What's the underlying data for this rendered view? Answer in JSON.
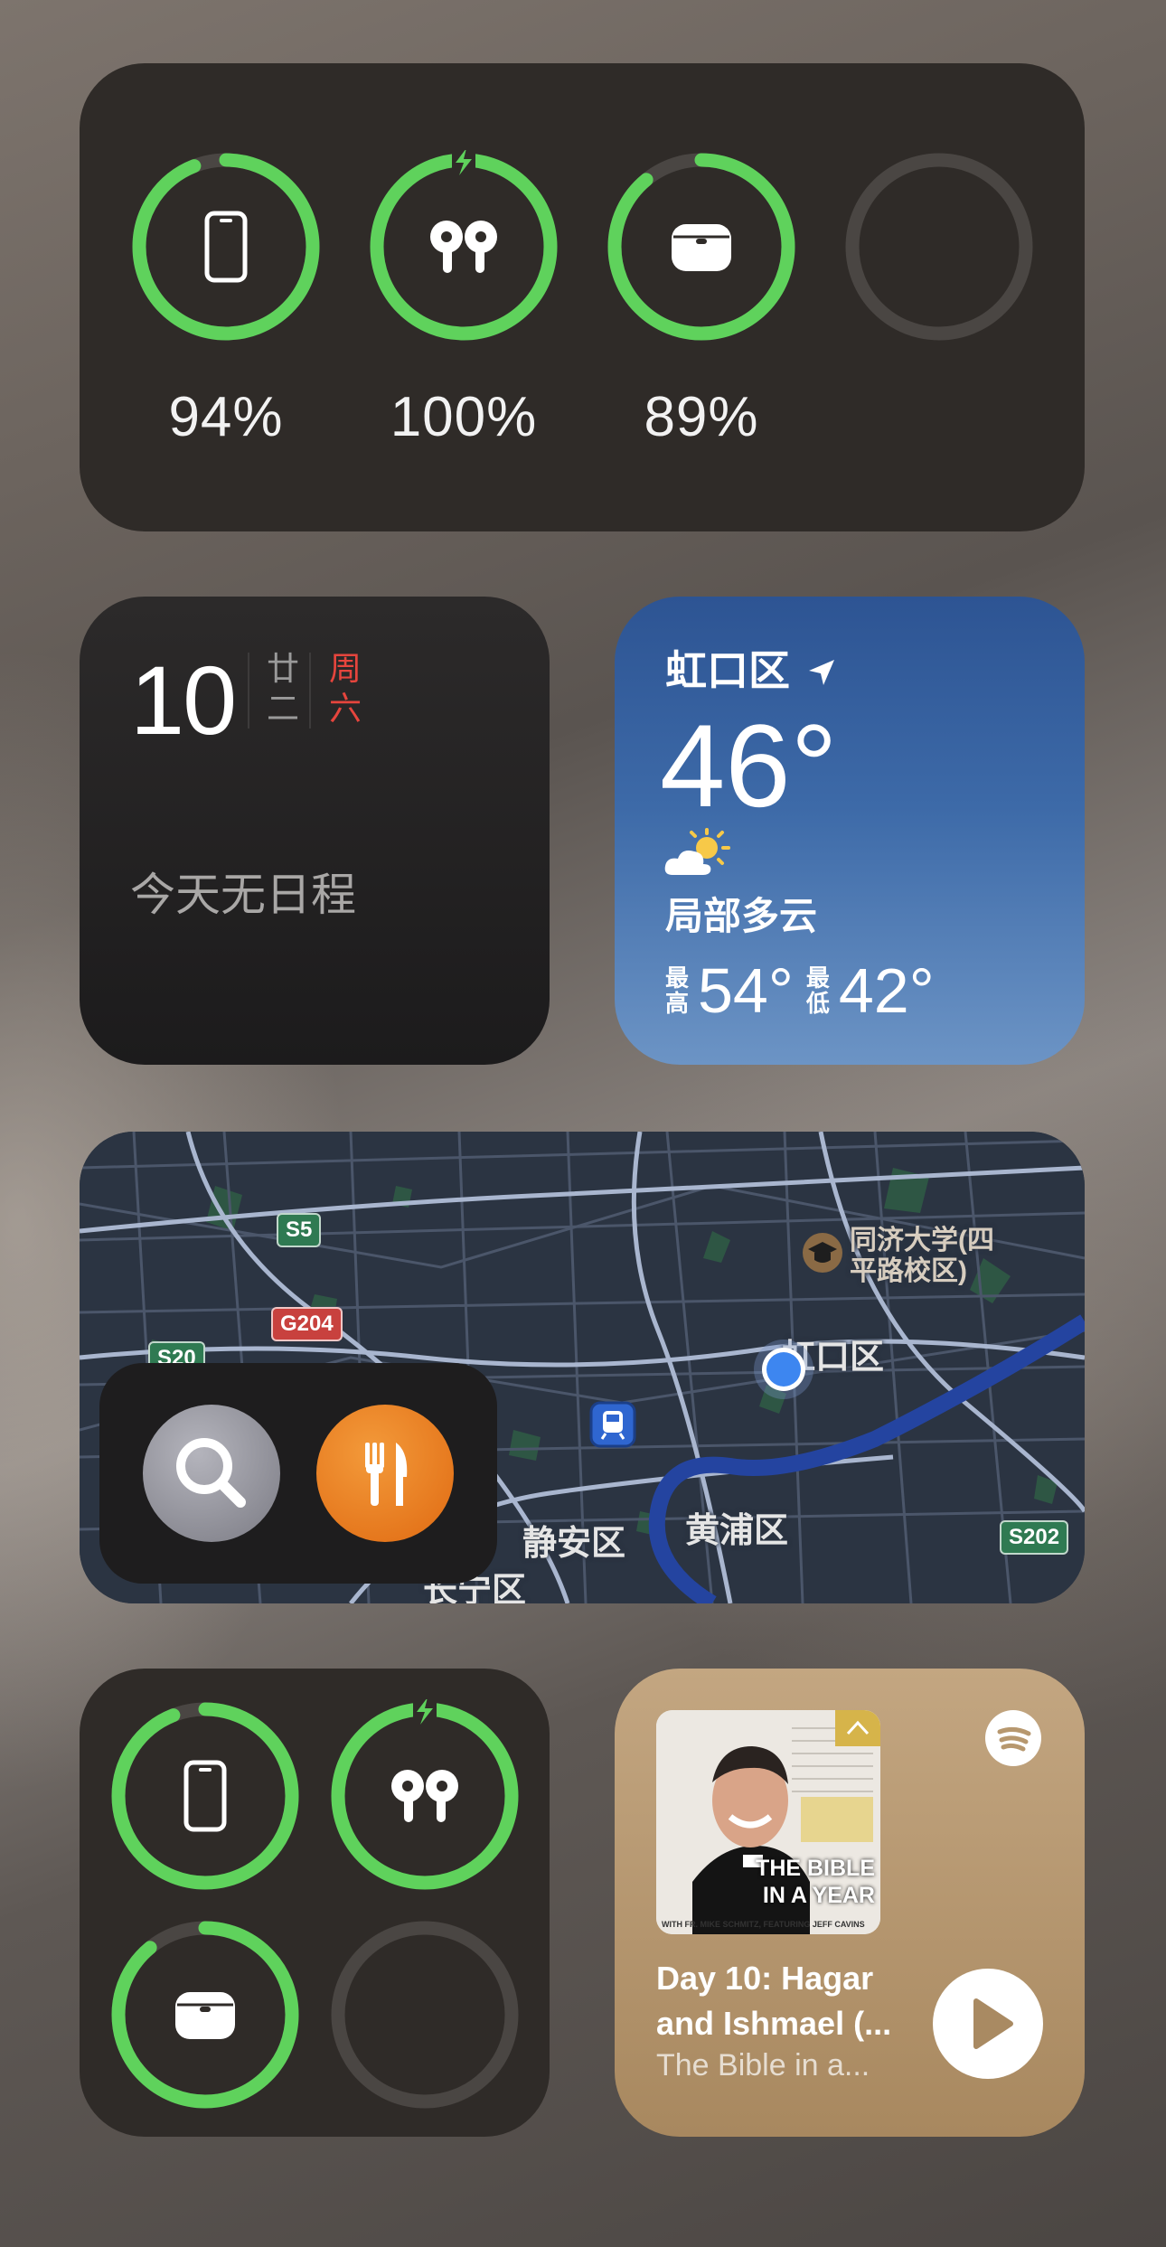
{
  "battery_large": {
    "devices": [
      {
        "icon": "iphone-icon",
        "percent": "94%",
        "level": 0.94,
        "charging": false
      },
      {
        "icon": "airpods-icon",
        "percent": "100%",
        "level": 1.0,
        "charging": true
      },
      {
        "icon": "airpods-case-icon",
        "percent": "89%",
        "level": 0.89,
        "charging": false
      },
      {
        "icon": "empty-slot",
        "percent": "",
        "level": 0,
        "charging": false
      }
    ]
  },
  "calendar": {
    "day": "10",
    "lunar_top": "廿",
    "lunar_bottom": "二",
    "weekday_top": "周",
    "weekday_bottom": "六",
    "empty_text": "今天无日程"
  },
  "weather": {
    "location": "虹口区",
    "temperature": "46°",
    "condition": "局部多云",
    "high_label_top": "最",
    "high_label_bottom": "高",
    "high": "54°",
    "low_label_top": "最",
    "low_label_bottom": "低",
    "low": "42°"
  },
  "map": {
    "labels": {
      "tongji": "同济大学(四平路校区)",
      "tongji_line1": "同济大学(四",
      "tongji_line2": "平路校区)",
      "hongkou": "虹口区",
      "jingan": "静安区",
      "huangpu": "黄浦区",
      "changning": "长宁区"
    },
    "road_signs": {
      "s5": "S5",
      "g204": "G204",
      "s20": "S20",
      "s202": "S202"
    }
  },
  "battery_small": {
    "devices": [
      {
        "icon": "iphone-icon",
        "level": 0.94,
        "charging": false
      },
      {
        "icon": "airpods-icon",
        "level": 1.0,
        "charging": true
      },
      {
        "icon": "airpods-case-icon",
        "level": 0.89,
        "charging": false
      },
      {
        "icon": "empty-slot",
        "level": 0,
        "charging": false
      }
    ]
  },
  "podcast": {
    "art_title_line1": "THE BIBLE",
    "art_title_line2": "IN A YEAR",
    "art_caption": "WITH FR. MIKE SCHMITZ, FEATURING JEFF CAVINS",
    "episode_title": "Day 10: Hagar and Ishmael (...",
    "show_name": "The Bible in a...",
    "colors": {
      "accent": "#b7986f"
    }
  },
  "colors": {
    "ring_green": "#5fd25c",
    "ring_track": "#4a4643"
  }
}
